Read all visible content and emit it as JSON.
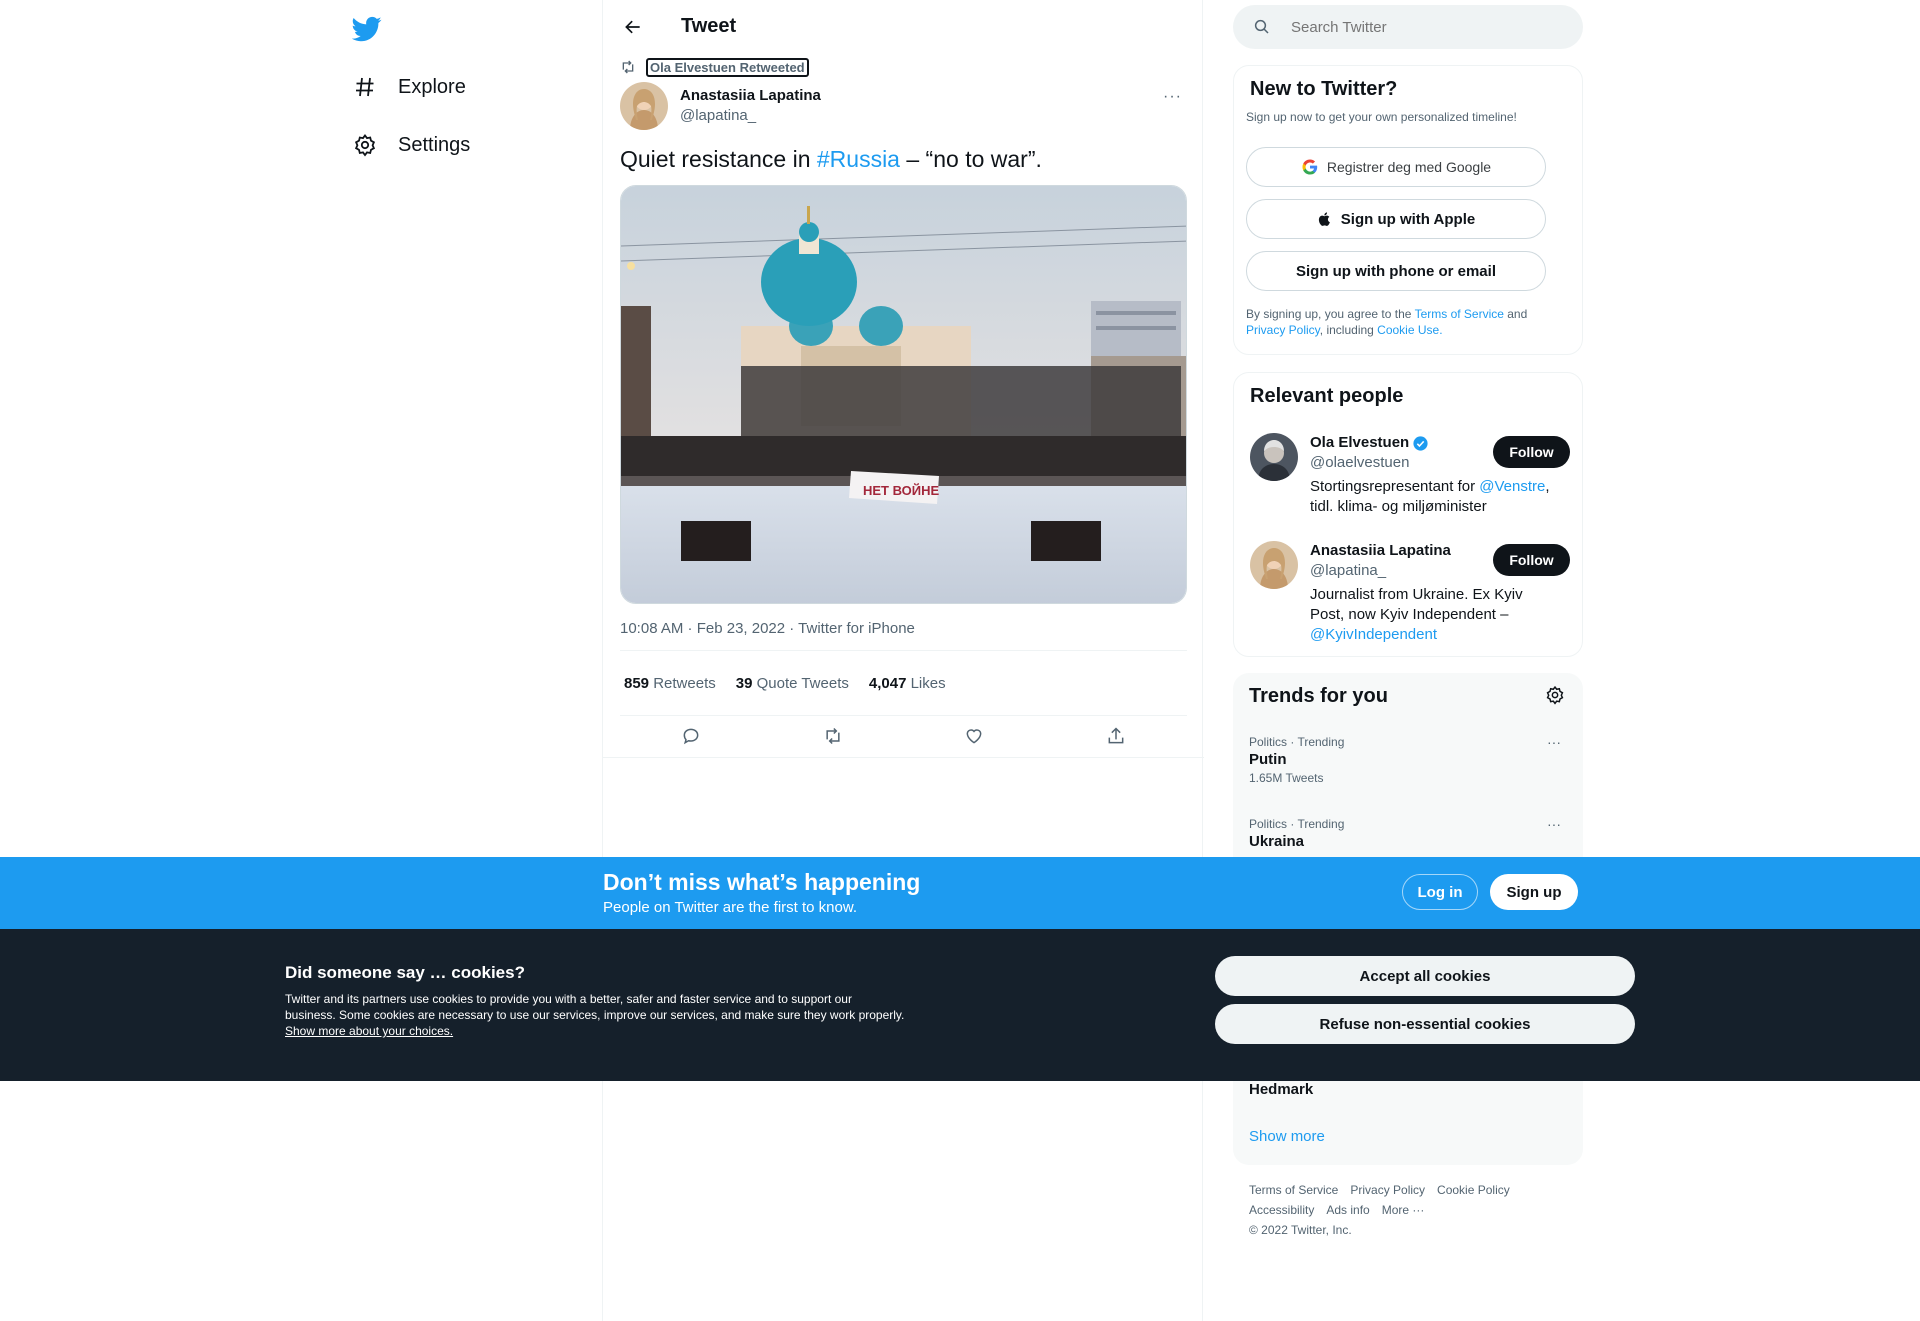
{
  "nav": {
    "logo": "twitter-bird-icon",
    "items": [
      {
        "label": "Explore",
        "icon": "hashtag-icon"
      },
      {
        "label": "Settings",
        "icon": "gear-icon"
      }
    ]
  },
  "header": {
    "title": "Tweet"
  },
  "tweet": {
    "retweeted_by": "Ola Elvestuen Retweeted",
    "author_name": "Anastasiia Lapatina",
    "author_handle": "@lapatina_",
    "text_before": "Quiet resistance in ",
    "hashtag": "#Russia",
    "text_after": " – “no to war”.",
    "banner_text": "НЕТ ВОЙНЕ",
    "meta": "10:08 AM · Feb 23, 2022 · Twitter for iPhone",
    "stats": [
      {
        "count": "859",
        "label": "Retweets"
      },
      {
        "count": "39",
        "label": "Quote Tweets"
      },
      {
        "count": "4,047",
        "label": "Likes"
      }
    ]
  },
  "search": {
    "placeholder": "Search Twitter"
  },
  "signup": {
    "title": "New to Twitter?",
    "subtitle": "Sign up now to get your own personalized timeline!",
    "google_label": "Registrer deg med Google",
    "apple_label": "Sign up with Apple",
    "phone_label": "Sign up with phone or email",
    "legal_1": "By signing up, you agree to the ",
    "terms": "Terms of Service",
    "legal_2": " and ",
    "privacy": "Privacy Policy",
    "legal_3": ", including ",
    "cookie": "Cookie Use."
  },
  "people": {
    "title": "Relevant people",
    "list": [
      {
        "name": "Ola Elvestuen",
        "handle": "@olaelvestuen",
        "bio_1": "Stortingsrepresentant for ",
        "bio_link": "@Venstre",
        "bio_2": ", tidl. klima- og miljøminister",
        "follow": "Follow"
      },
      {
        "name": "Anastasiia Lapatina",
        "handle": "@lapatina_",
        "bio_1": "Journalist from Ukraine. Ex Kyiv Post, now Kyiv Independent – ",
        "bio_link": "@KyivIndependent",
        "bio_2": "",
        "follow": "Follow"
      }
    ]
  },
  "trends": {
    "title": "Trends for you",
    "list": [
      {
        "category": "Politics · Trending",
        "name": "Putin",
        "count": "1.65M Tweets"
      },
      {
        "category": "Politics · Trending",
        "name": "Ukraina",
        "count": ""
      }
    ],
    "partial_last": "Hedmark",
    "show_more": "Show more"
  },
  "footer": {
    "links": [
      "Terms of Service",
      "Privacy Policy",
      "Cookie Policy",
      "Accessibility",
      "Ads info",
      "More ···"
    ],
    "copyright": "© 2022 Twitter, Inc."
  },
  "bottom_bar": {
    "title": "Don’t miss what’s happening",
    "subtitle": "People on Twitter are the first to know.",
    "login": "Log in",
    "signup": "Sign up"
  },
  "cookies": {
    "title": "Did someone say … cookies?",
    "text": "Twitter and its partners use cookies to provide you with a better, safer and faster service and to support our business. Some cookies are necessary to use our services, improve our services, and make sure they work properly. ",
    "link": "Show more about your choices.",
    "accept": "Accept all cookies",
    "refuse": "Refuse non-essential cookies"
  },
  "colors": {
    "accent": "#1d9bf0",
    "dark": "#0f1419",
    "cookie_bg": "#15202b"
  }
}
